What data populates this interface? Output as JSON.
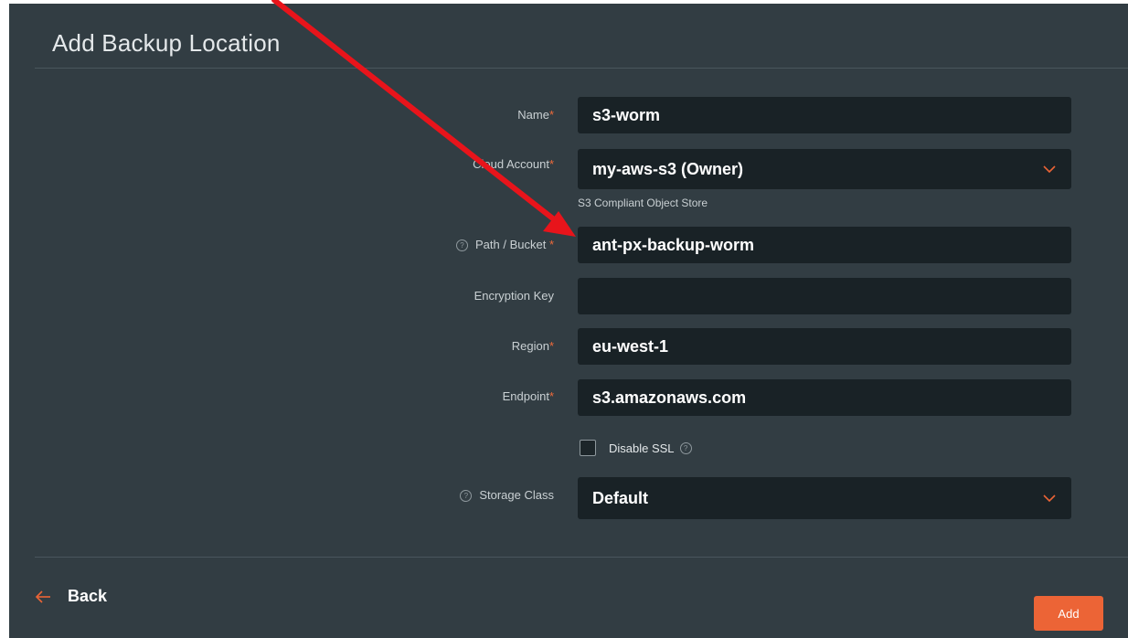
{
  "dialog": {
    "title": "Add Backup Location"
  },
  "fields": {
    "name": {
      "label": "Name",
      "required": "*",
      "value": "s3-worm"
    },
    "cloud_account": {
      "label": "Cloud Account",
      "required": "*",
      "value": "my-aws-s3 (Owner)",
      "hint": "S3 Compliant Object Store"
    },
    "path_bucket": {
      "label": "Path / Bucket ",
      "required": "*",
      "value": "ant-px-backup-worm"
    },
    "encryption_key": {
      "label": "Encryption Key",
      "value": ""
    },
    "region": {
      "label": "Region",
      "required": "*",
      "value": "eu-west-1"
    },
    "endpoint": {
      "label": "Endpoint",
      "required": "*",
      "value": "s3.amazonaws.com"
    },
    "disable_ssl": {
      "label": "Disable SSL",
      "checked": false
    },
    "storage_class": {
      "label": "Storage Class",
      "value": "Default"
    }
  },
  "footer": {
    "back_label": "Back",
    "add_label": "Add"
  },
  "icons": {
    "help": "help-circle-icon",
    "chevron": "chevron-down-icon",
    "back": "arrow-left-icon"
  },
  "colors": {
    "accent": "#ec6436",
    "panel": "#323d43",
    "input": "#192226",
    "annotation_arrow": "#e8141b"
  }
}
